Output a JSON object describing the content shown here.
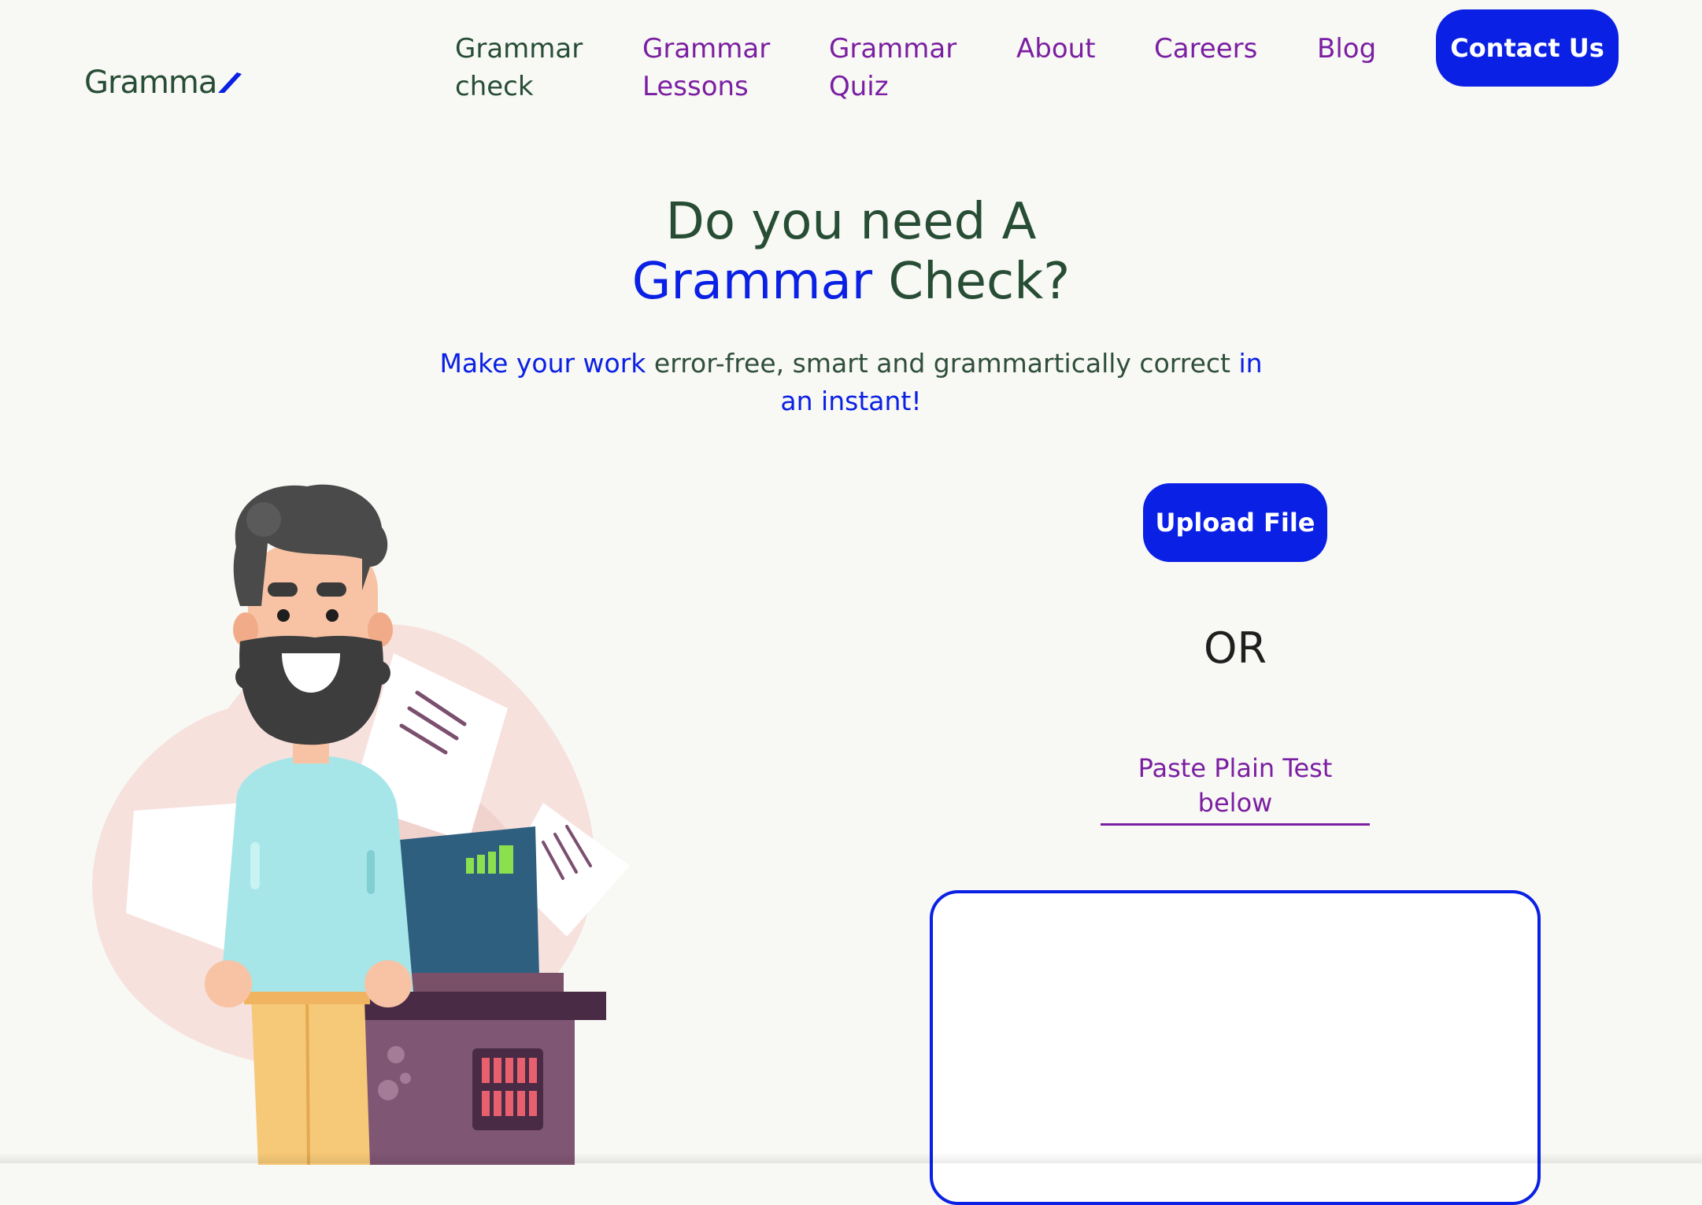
{
  "header": {
    "logo_text": "Gramma",
    "nav": [
      {
        "line1": "Grammar",
        "line2": "check"
      },
      {
        "line1": "Grammar",
        "line2": "Lessons"
      },
      {
        "line1": "Grammar",
        "line2": "Quiz"
      },
      {
        "line1": "About",
        "line2": ""
      },
      {
        "line1": "Careers",
        "line2": ""
      },
      {
        "line1": "Blog",
        "line2": ""
      }
    ],
    "contact_label": "Contact Us"
  },
  "hero": {
    "title_line1": "Do you need A",
    "title_highlight": "Grammar",
    "title_rest": " Check?",
    "sub_hl1": "Make your work",
    "sub_mid": " error-free, smart and grammartically correct ",
    "sub_hl2": "in an instant!"
  },
  "checker": {
    "upload_label": "Upload File",
    "or_label": "OR",
    "paste_label": "Paste Plain Test below",
    "text_value": ""
  },
  "colors": {
    "brand_blue": "#0a20e4",
    "brand_green": "#274d35",
    "nav_purple": "#7b1fa2",
    "background": "#f8f8f4"
  }
}
